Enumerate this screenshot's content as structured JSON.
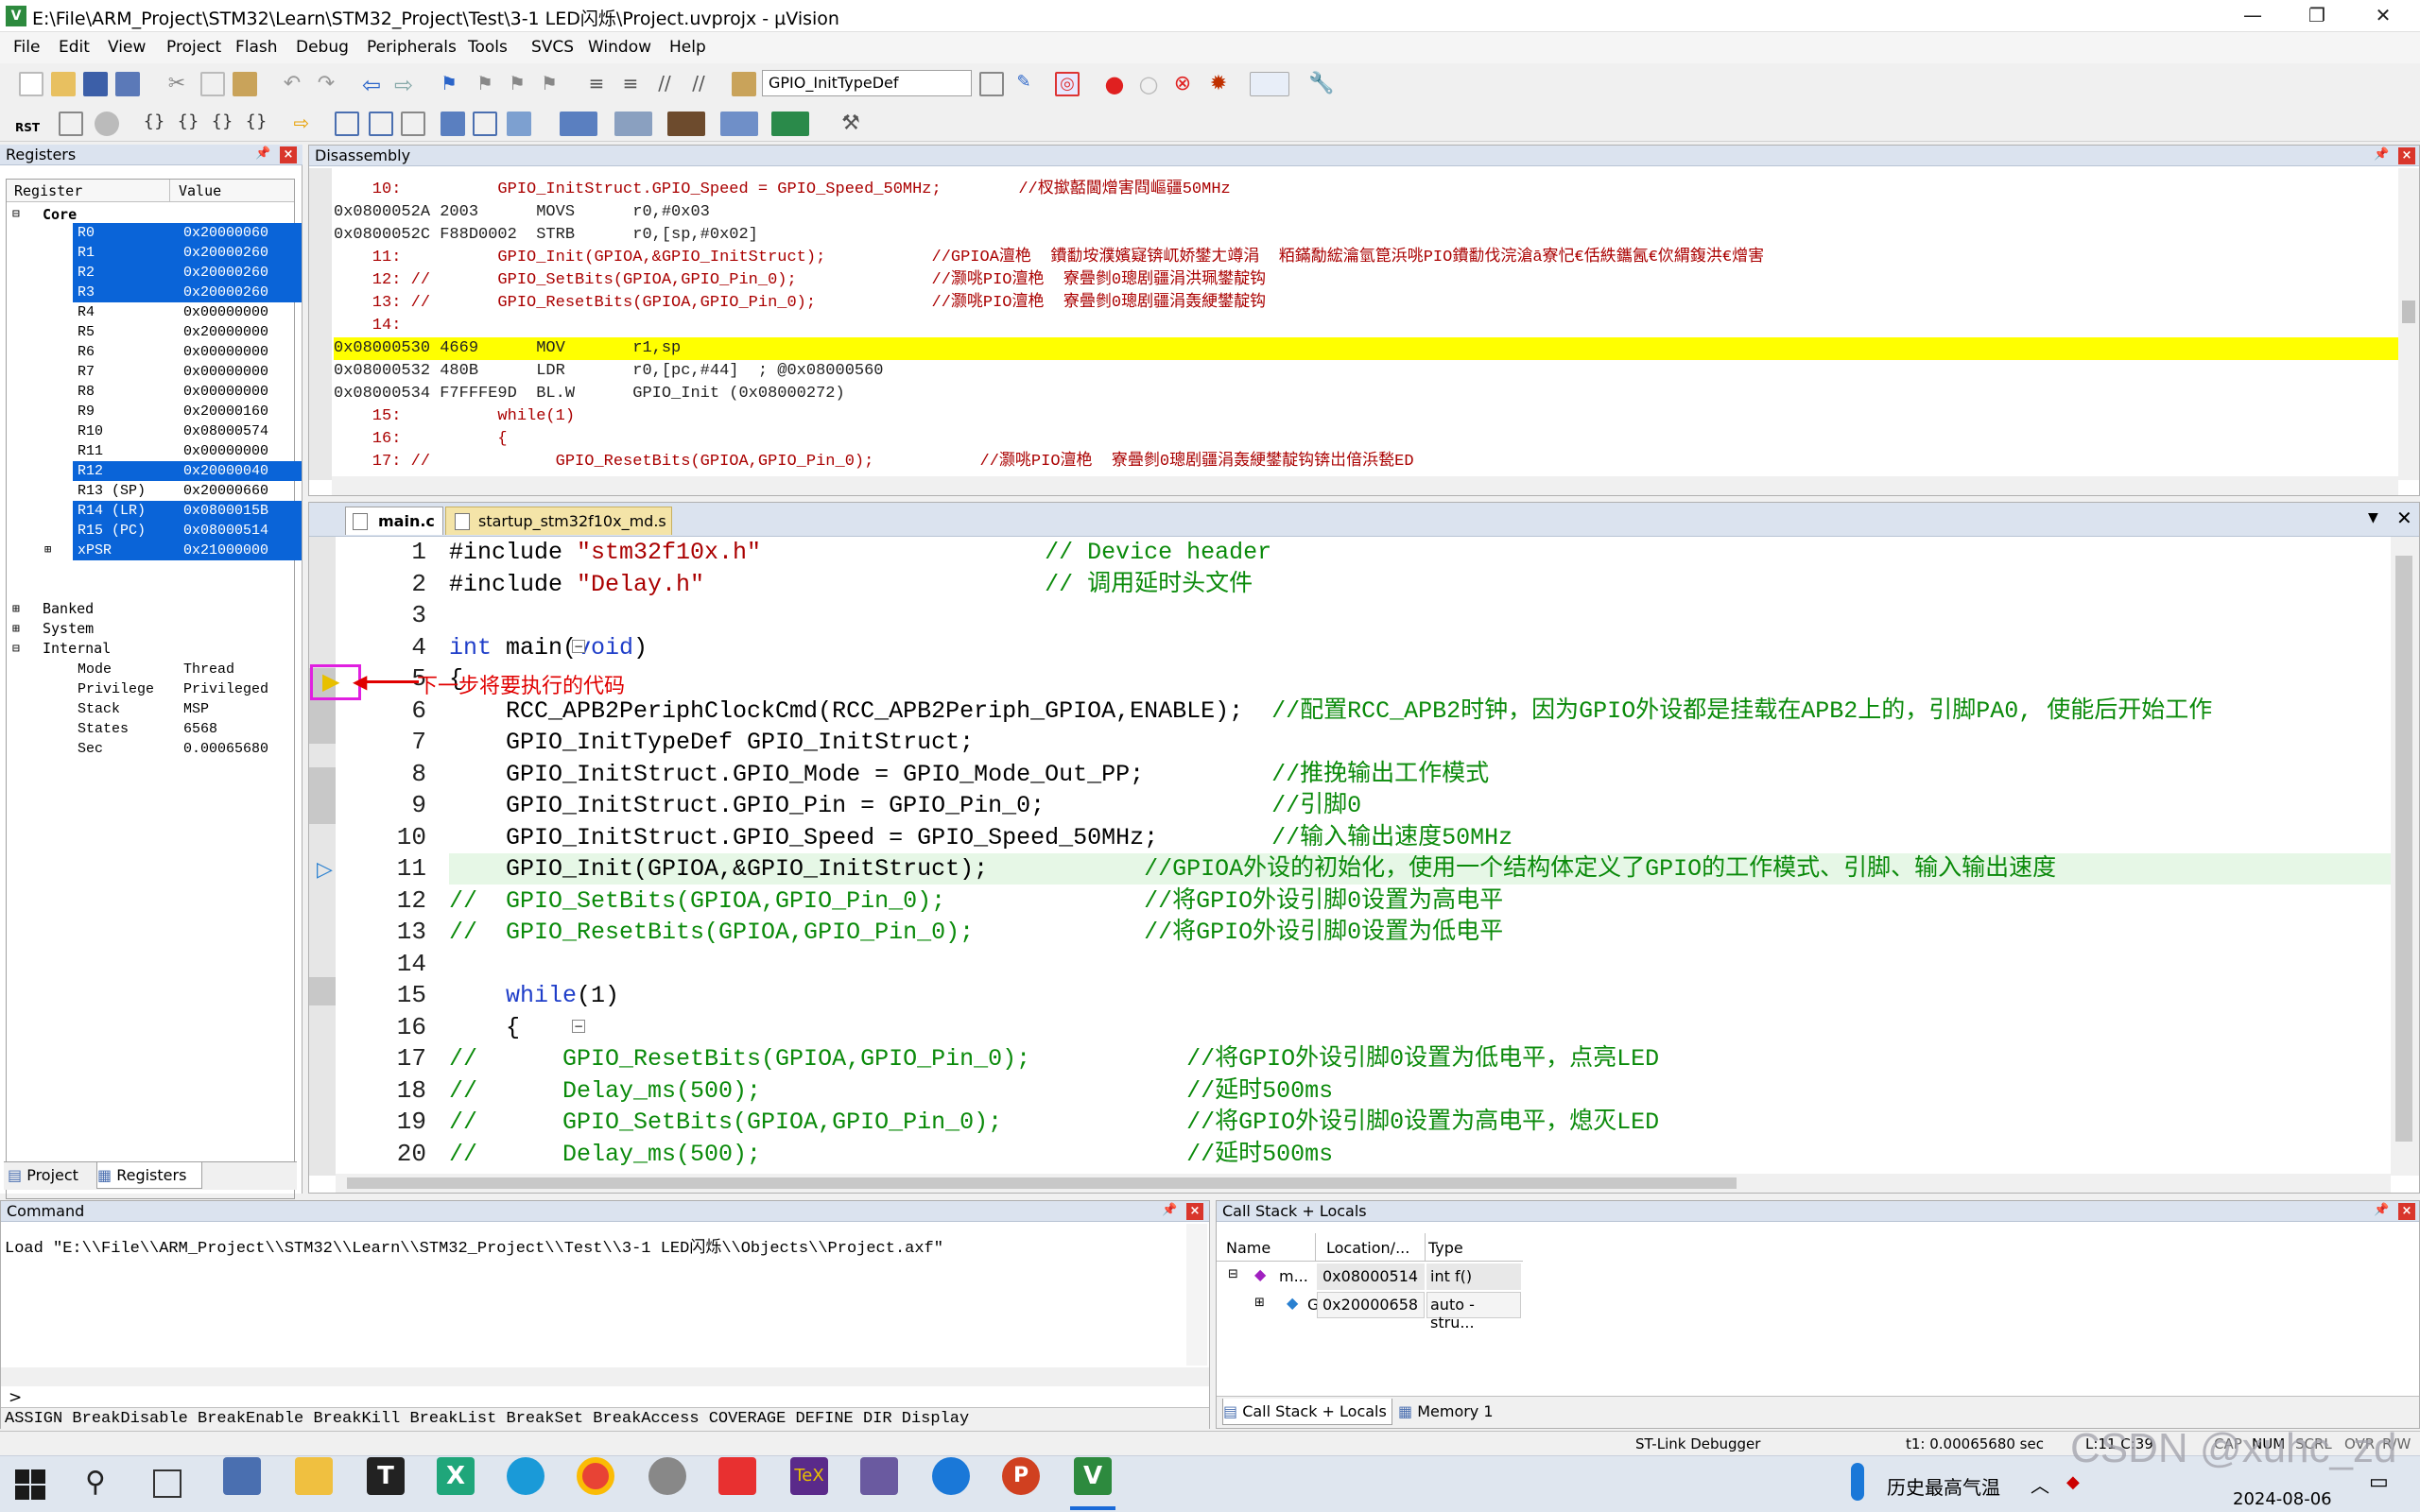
{
  "window": {
    "title": "E:\\File\\ARM_Project\\STM32\\Learn\\STM32_Project\\Test\\3-1 LED闪烁\\Project.uvprojx - µVision",
    "minimize": "—",
    "restore": "❐",
    "close": "✕"
  },
  "menu": [
    "File",
    "Edit",
    "View",
    "Project",
    "Flash",
    "Debug",
    "Peripherals",
    "Tools",
    "SVCS",
    "Window",
    "Help"
  ],
  "toolbar": {
    "combo_value": "GPIO_InitTypeDef",
    "rst_label": "RST"
  },
  "registers": {
    "title": "Registers",
    "col_register": "Register",
    "col_value": "Value",
    "core_label": "Core",
    "rows": [
      {
        "name": "R0",
        "value": "0x20000060",
        "sel": true
      },
      {
        "name": "R1",
        "value": "0x20000260",
        "sel": true
      },
      {
        "name": "R2",
        "value": "0x20000260",
        "sel": true
      },
      {
        "name": "R3",
        "value": "0x20000260",
        "sel": true
      },
      {
        "name": "R4",
        "value": "0x00000000",
        "sel": false
      },
      {
        "name": "R5",
        "value": "0x20000000",
        "sel": false
      },
      {
        "name": "R6",
        "value": "0x00000000",
        "sel": false
      },
      {
        "name": "R7",
        "value": "0x00000000",
        "sel": false
      },
      {
        "name": "R8",
        "value": "0x00000000",
        "sel": false
      },
      {
        "name": "R9",
        "value": "0x20000160",
        "sel": false
      },
      {
        "name": "R10",
        "value": "0x08000574",
        "sel": false
      },
      {
        "name": "R11",
        "value": "0x00000000",
        "sel": false
      },
      {
        "name": "R12",
        "value": "0x20000040",
        "sel": true
      },
      {
        "name": "R13 (SP)",
        "value": "0x20000660",
        "sel": false
      },
      {
        "name": "R14 (LR)",
        "value": "0x0800015B",
        "sel": true
      },
      {
        "name": "R15 (PC)",
        "value": "0x08000514",
        "sel": true
      },
      {
        "name": "xPSR",
        "value": "0x21000000",
        "sel": true
      }
    ],
    "groups": [
      "Banked",
      "System",
      "Internal"
    ],
    "internal": [
      {
        "name": "Mode",
        "value": "Thread"
      },
      {
        "name": "Privilege",
        "value": "Privileged"
      },
      {
        "name": "Stack",
        "value": "MSP"
      },
      {
        "name": "States",
        "value": "6568"
      },
      {
        "name": "Sec",
        "value": "0.00065680"
      }
    ],
    "tab_project": "Project",
    "tab_registers": "Registers"
  },
  "disassembly": {
    "title": "Disassembly",
    "lines": [
      {
        "t": "    10:          GPIO_InitStruct.GPIO_Speed = GPIO_Speed_50MHz;        //杈撳嚭閫熷害閰嶇疆50MHz",
        "src": true
      },
      {
        "t": "0x0800052A 2003      MOVS      r0,#0x03",
        "src": false
      },
      {
        "t": "0x0800052C F88D0002  STRB      r0,[sp,#0x02]",
        "src": false
      },
      {
        "t": "    11:          GPIO_Init(GPIOA,&GPIO_InitStruct);           //GPIOA澶栬  鐨勫垵濮嬪寲锛屼娇鐢ㄤ竴涓  粨鏋勪綋瀹氫箟浜咷PIO鐨勫伐浣滄ā寮忋€佸紩鑴氥€佽緭鍑洪€熷害",
        "src": true
      },
      {
        "t": "    12: //       GPIO_SetBits(GPIOA,GPIO_Pin_0);              //灏咷PIO澶栬  寮曡剼0璁剧疆涓洪珮鐢靛钩",
        "src": true
      },
      {
        "t": "    13: //       GPIO_ResetBits(GPIOA,GPIO_Pin_0);            //灏咷PIO澶栬  寮曡剼0璁剧疆涓轰綆鐢靛钩",
        "src": true
      },
      {
        "t": "    14: ",
        "src": true
      },
      {
        "t": "0x08000530 4669      MOV       r1,sp",
        "src": false,
        "hl": true
      },
      {
        "t": "0x08000532 480B      LDR       r0,[pc,#44]  ; @0x08000560",
        "src": false
      },
      {
        "t": "0x08000534 F7FFFE9D  BL.W      GPIO_Init (0x08000272)",
        "src": false
      },
      {
        "t": "    15:          while(1)",
        "src": true
      },
      {
        "t": "    16:          {",
        "src": true
      },
      {
        "t": "    17: //             GPIO_ResetBits(GPIOA,GPIO_Pin_0);           //灏咷PIO澶栬  寮曡剼0璁剧疆涓轰綆鐢靛钩锛岀偣浜甃ED",
        "src": true
      }
    ]
  },
  "editor": {
    "tab_main": "main.c",
    "tab_startup": "startup_stm32f10x_md.s",
    "annotation": "下一步将要执行的代码",
    "lines": [
      {
        "n": "1",
        "parts": [
          [
            "pp",
            "#include "
          ],
          [
            "str",
            "\"stm32f10x.h\""
          ],
          [
            "pad",
            "                    "
          ],
          [
            "cm",
            "// Device header"
          ]
        ]
      },
      {
        "n": "2",
        "parts": [
          [
            "pp",
            "#include "
          ],
          [
            "str",
            "\"Delay.h\""
          ],
          [
            "pad",
            "                        "
          ],
          [
            "cm",
            "// 调用延时头文件"
          ]
        ]
      },
      {
        "n": "3",
        "parts": []
      },
      {
        "n": "4",
        "parts": [
          [
            "kw",
            "int"
          ],
          [
            "pp",
            " main("
          ],
          [
            "kw",
            "void"
          ],
          [
            "pp",
            ")"
          ]
        ]
      },
      {
        "n": "5",
        "parts": [
          [
            "pp",
            "{"
          ]
        ]
      },
      {
        "n": "6",
        "parts": [
          [
            "pp",
            "    RCC_APB2PeriphClockCmd(RCC_APB2Periph_GPIOA,ENABLE);  "
          ],
          [
            "cm",
            "//配置RCC_APB2时钟，因为GPIO外设都是挂载在APB2上的，引脚PA0, 使能后开始工作"
          ]
        ]
      },
      {
        "n": "7",
        "parts": [
          [
            "pp",
            "    GPIO_InitTypeDef GPIO_InitStruct;"
          ]
        ]
      },
      {
        "n": "8",
        "parts": [
          [
            "pp",
            "    GPIO_InitStruct.GPIO_Mode = GPIO_Mode_Out_PP;         "
          ],
          [
            "cm",
            "//推挽输出工作模式"
          ]
        ]
      },
      {
        "n": "9",
        "parts": [
          [
            "pp",
            "    GPIO_InitStruct.GPIO_Pin = GPIO_Pin_0;                "
          ],
          [
            "cm",
            "//引脚0"
          ]
        ]
      },
      {
        "n": "10",
        "parts": [
          [
            "pp",
            "    GPIO_InitStruct.GPIO_Speed = GPIO_Speed_50MHz;        "
          ],
          [
            "cm",
            "//输入输出速度50MHz"
          ]
        ]
      },
      {
        "n": "11",
        "parts": [
          [
            "pp",
            "    GPIO_Init(GPIOA,&GPIO_InitStruct);           "
          ],
          [
            "cm",
            "//GPIOA外设的初始化，使用一个结构体定义了GPIO的工作模式、引脚、输入输出速度"
          ]
        ],
        "hl": true
      },
      {
        "n": "12",
        "parts": [
          [
            "cm",
            "//  GPIO_SetBits(GPIOA,GPIO_Pin_0);              //将GPIO外设引脚0设置为高电平"
          ]
        ]
      },
      {
        "n": "13",
        "parts": [
          [
            "cm",
            "//  GPIO_ResetBits(GPIOA,GPIO_Pin_0);            //将GPIO外设引脚0设置为低电平"
          ]
        ]
      },
      {
        "n": "14",
        "parts": []
      },
      {
        "n": "15",
        "parts": [
          [
            "pp",
            "    "
          ],
          [
            "kw",
            "while"
          ],
          [
            "pp",
            "(1)"
          ]
        ]
      },
      {
        "n": "16",
        "parts": [
          [
            "pp",
            "    {"
          ]
        ]
      },
      {
        "n": "17",
        "parts": [
          [
            "cm",
            "//      GPIO_ResetBits(GPIOA,GPIO_Pin_0);           //将GPIO外设引脚0设置为低电平，点亮LED"
          ]
        ]
      },
      {
        "n": "18",
        "parts": [
          [
            "cm",
            "//      Delay_ms(500);                              //延时500ms"
          ]
        ]
      },
      {
        "n": "19",
        "parts": [
          [
            "cm",
            "//      GPIO_SetBits(GPIOA,GPIO_Pin_0);             //将GPIO外设引脚0设置为高电平，熄灭LED"
          ]
        ]
      },
      {
        "n": "20",
        "parts": [
          [
            "cm",
            "//      Delay_ms(500);                              //延时500ms"
          ]
        ]
      }
    ]
  },
  "command": {
    "title": "Command",
    "output": "Load \"E:\\\\File\\\\ARM_Project\\\\STM32\\\\Learn\\\\STM32_Project\\\\Test\\\\3-1 LED闪烁\\\\Objects\\\\Project.axf\"",
    "prompt": ">",
    "hints": "ASSIGN BreakDisable BreakEnable BreakKill BreakList BreakSet BreakAccess COVERAGE DEFINE DIR Display"
  },
  "callstack": {
    "title": "Call Stack + Locals",
    "col_name": "Name",
    "col_location": "Location/...",
    "col_type": "Type",
    "rows": [
      {
        "name": "m...",
        "location": "0x08000514",
        "type": "int f()"
      },
      {
        "name": "G",
        "location": "0x20000658",
        "type": "auto - stru..."
      }
    ],
    "tab_callstack": "Call Stack + Locals",
    "tab_memory": "Memory 1"
  },
  "status": {
    "debugger": "ST-Link Debugger",
    "time": "t1: 0.00065680 sec",
    "pos": "L:11 C:39",
    "caps": "CAP",
    "num": "NUM",
    "scrl": "SCRL",
    "ovr": "OVR",
    "rw": "R/W"
  },
  "taskbar": {
    "weather": "历史最高气温",
    "date": "2024-08-06",
    "watermark": "CSDN @xuhc_zd"
  },
  "colors": {
    "accent": "#0a64d8",
    "highlight": "#ffff00",
    "comment": "#0a8a0a",
    "keyword": "#1f3ec9",
    "string": "#a00000"
  }
}
